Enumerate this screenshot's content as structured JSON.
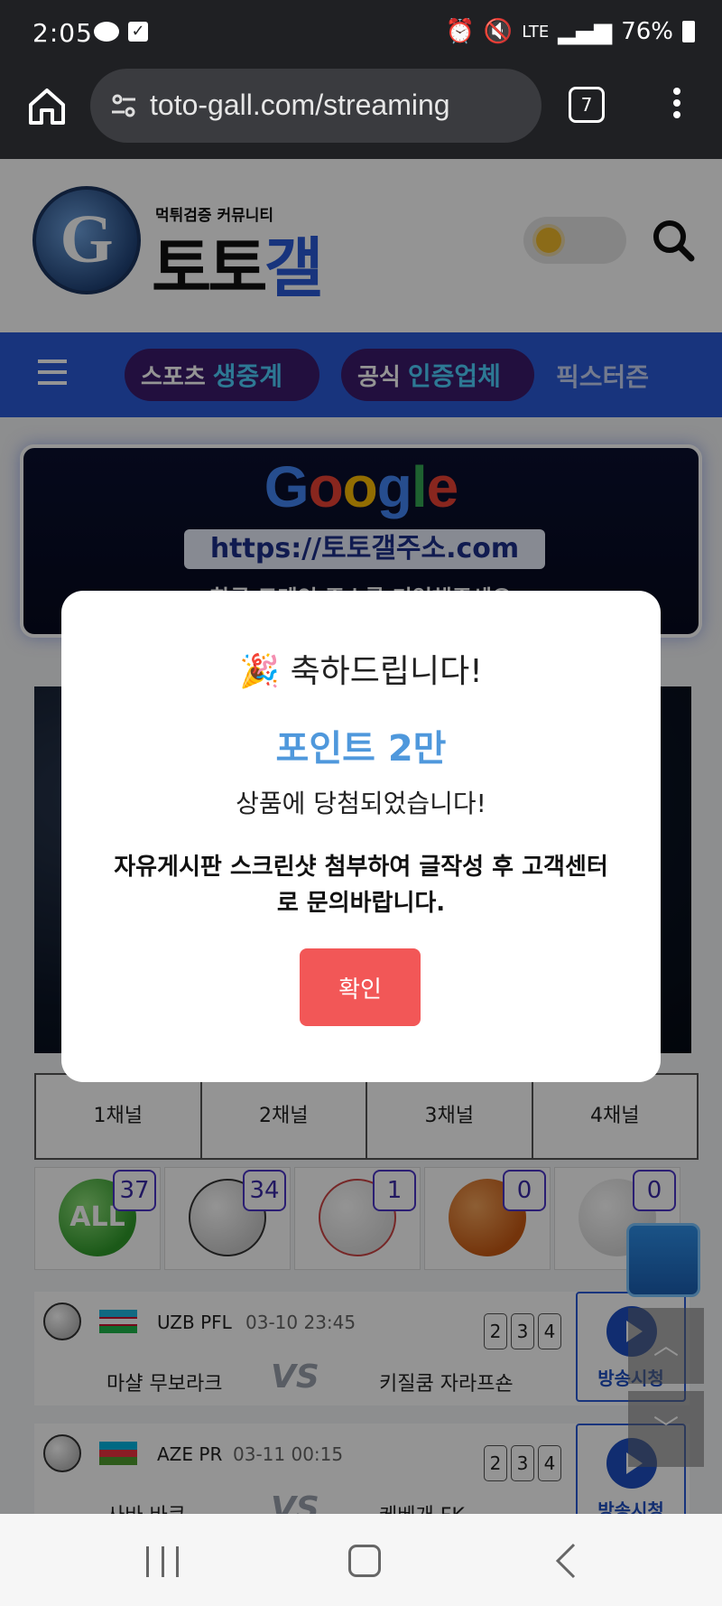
{
  "status_bar": {
    "time": "2:05",
    "network": "LTE",
    "battery": "76%"
  },
  "browser": {
    "url": "toto-gall.com/streaming",
    "tab_count": "7"
  },
  "site": {
    "logo_tagline": "먹튀검증 커뮤니티",
    "logo_black": "토토",
    "logo_blue": "갤"
  },
  "nav": {
    "pill1": {
      "main": "스포츠",
      "accent": "생중계"
    },
    "pill2": {
      "main": "공식",
      "accent": "인증업체"
    },
    "text_item": "픽스터즌"
  },
  "banner": {
    "google": "Google",
    "url": "https://토토갤주소.com",
    "sub": "한글 도메인 주소를 기억해주세요"
  },
  "channels": [
    "1채널",
    "2채널",
    "3채널",
    "4채널"
  ],
  "sports": [
    {
      "label": "ALL",
      "count": "37"
    },
    {
      "label": "",
      "count": "34"
    },
    {
      "label": "",
      "count": "1"
    },
    {
      "label": "",
      "count": "0"
    },
    {
      "label": "",
      "count": "0"
    }
  ],
  "matches": [
    {
      "league": "UZB PFL",
      "date": "03-10 23:45",
      "home": "마샬 무보라크",
      "vs": "VS",
      "away": "키질쿰 자라프숀",
      "nums": [
        "2",
        "3",
        "4"
      ],
      "watch_label": "방송시청"
    },
    {
      "league": "AZE PR",
      "date": "03-11 00:15",
      "home": "사바 바쿠",
      "vs": "VS",
      "away": "케베개 FK",
      "nums": [
        "2",
        "3",
        "4"
      ],
      "watch_label": "방송시청"
    }
  ],
  "modal": {
    "emoji": "🎉",
    "title": "축하드립니다!",
    "points": "포인트 2만",
    "won": "상품에 당첨되었습니다!",
    "instructions": "자유게시판 스크린샷 첨부하여 글작성 후 고객센터로 문의바랍니다.",
    "confirm": "확인"
  },
  "colors": {
    "nav_blue": "#2a5bd7",
    "points_blue": "#4f98dc",
    "confirm_red": "#f25757"
  }
}
